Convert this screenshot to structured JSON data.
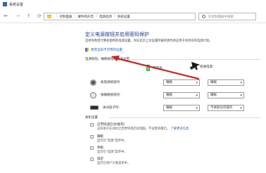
{
  "window": {
    "title": "系统设置"
  },
  "address_bar": {
    "breadcrumb": [
      "控制面板",
      "硬件和声音",
      "电源选项",
      "系统设置"
    ],
    "search_placeholder": "在控制面板中搜索"
  },
  "page": {
    "heading": "定义电源按钮并启用密码保护",
    "subtitle": "选择你希望计算机使用的电源设置。你在此页上对设置所做的更改将应用于你所有的电源计划。",
    "change_link": "更改当前不可用的设置"
  },
  "power_section": {
    "title": "电源按钮、睡眠按钮和盖子设置",
    "columns": {
      "battery": "用电池",
      "ac": "接通电源"
    },
    "rows": [
      {
        "label": "按电源按钮时:",
        "battery": "睡眠",
        "ac": "睡眠"
      },
      {
        "label": "按睡眠按钮时:",
        "battery": "睡眠",
        "ac": "睡眠"
      },
      {
        "label": "关闭盖子时:",
        "battery": "睡眠",
        "ac": "不采取任何操作"
      }
    ]
  },
  "shutdown_section": {
    "title": "关机设置",
    "items": [
      {
        "label": "启用快速启动(推荐)",
        "desc": "这有助于在关机之后更快地启动电脑。不会影响重启。",
        "link": "了解更多信息"
      },
      {
        "label": "睡眠",
        "desc": "显示在\"电源\"菜单中。"
      },
      {
        "label": "休眠",
        "desc": "显示在\"电源\"菜单中。"
      },
      {
        "label": "锁定",
        "desc": "显示在用户头像菜单中。"
      }
    ]
  },
  "icons": {
    "window": "power-options-icon",
    "back": "arrow-left-icon",
    "forward": "arrow-right-icon",
    "up": "arrow-up-icon",
    "refresh": "refresh-icon",
    "search": "search-icon",
    "shield": "shield-icon",
    "battery": "battery-icon",
    "plug": "plug-icon"
  },
  "colors": {
    "heading": "#1e3a8a",
    "link": "#1a5fb4",
    "annotation": "#c62828"
  }
}
